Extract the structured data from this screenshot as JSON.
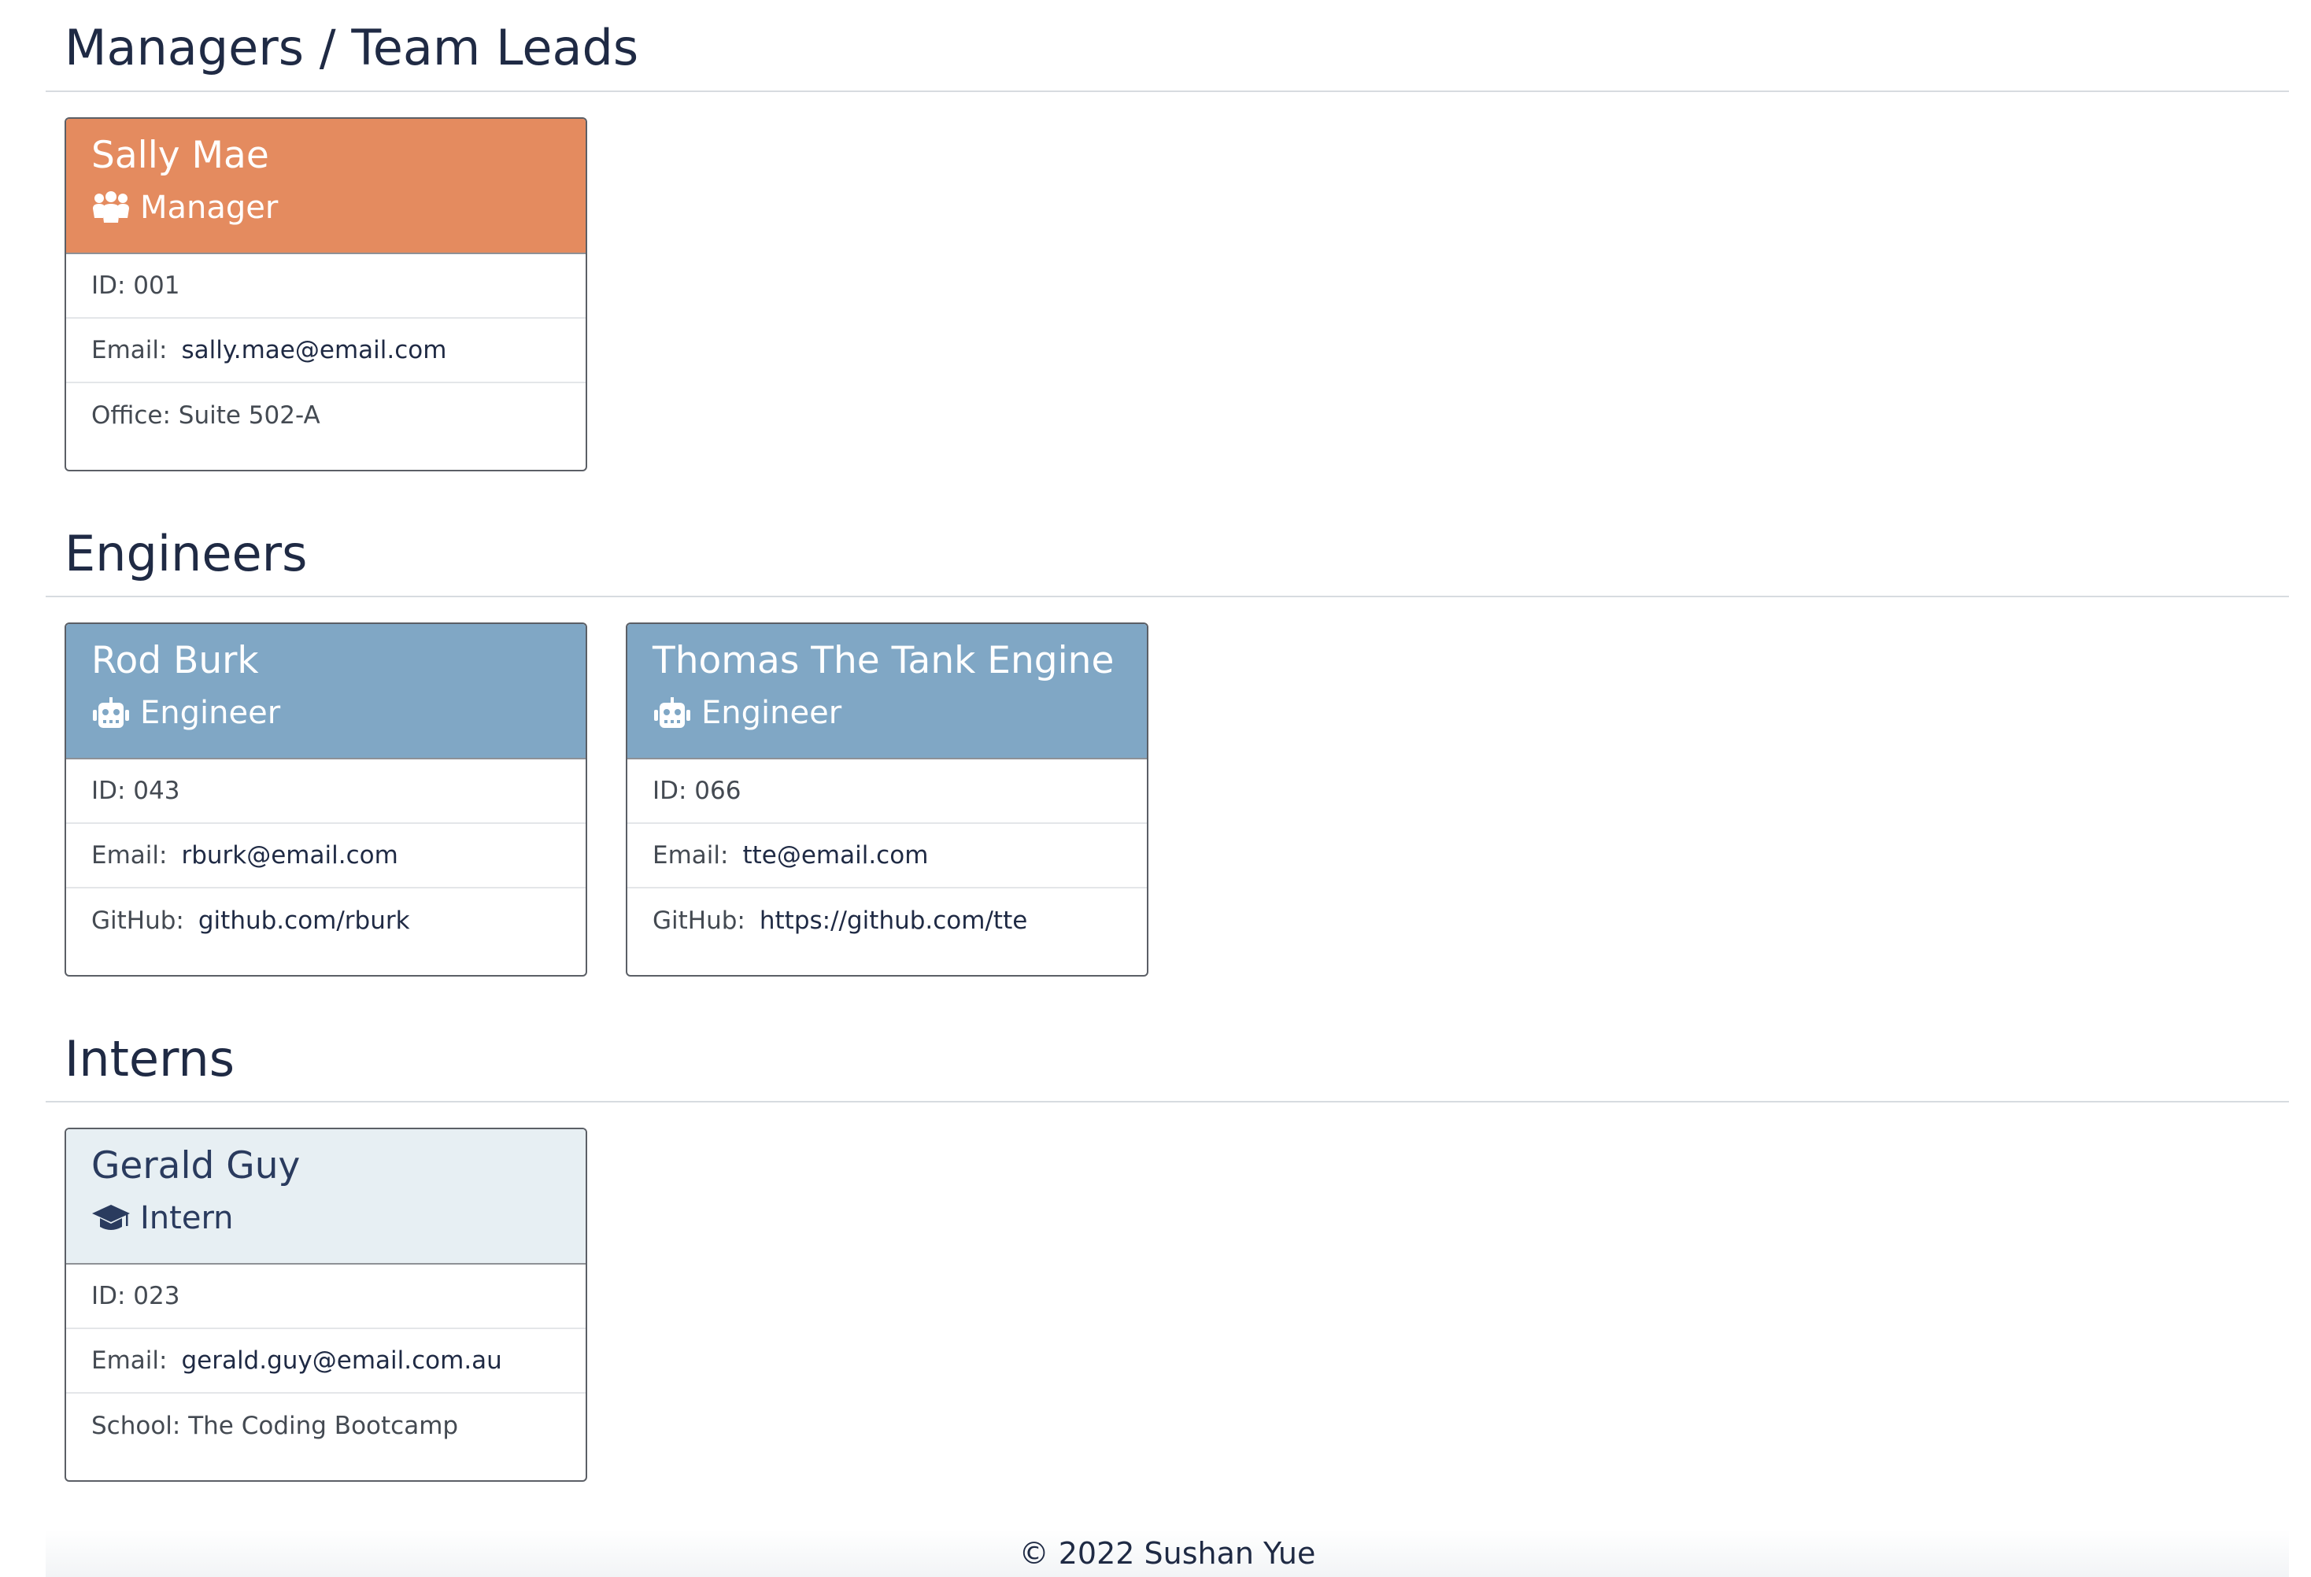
{
  "sections": {
    "managers": {
      "title": "Managers / Team Leads",
      "cards": [
        {
          "name": "Sally Mae",
          "role": "Manager",
          "role_icon": "people-group-icon",
          "id_text": "ID: 001",
          "email_label": "Email:",
          "email": "sally.mae@email.com",
          "extra_text": "Office: Suite 502-A"
        }
      ]
    },
    "engineers": {
      "title": "Engineers",
      "cards": [
        {
          "name": "Rod Burk",
          "role": "Engineer",
          "role_icon": "robot-icon",
          "id_text": "ID: 043",
          "email_label": "Email:",
          "email": "rburk@email.com",
          "github_label": "GitHub:",
          "github": "github.com/rburk"
        },
        {
          "name": "Thomas The Tank Engine",
          "role": "Engineer",
          "role_icon": "robot-icon",
          "id_text": "ID: 066",
          "email_label": "Email:",
          "email": "tte@email.com",
          "github_label": "GitHub:",
          "github": "https://github.com/tte"
        }
      ]
    },
    "interns": {
      "title": "Interns",
      "cards": [
        {
          "name": "Gerald Guy",
          "role": "Intern",
          "role_icon": "graduation-cap-icon",
          "id_text": "ID: 023",
          "email_label": "Email:",
          "email": "gerald.guy@email.com.au",
          "extra_text": "School: The Coding Bootcamp"
        }
      ]
    }
  },
  "colors": {
    "manager_header": "#e48b5f",
    "engineer_header": "#80a7c5",
    "intern_header": "#e7eff3",
    "text_dark": "#1f2a44"
  },
  "footer": {
    "text": "© 2022 Sushan Yue"
  }
}
